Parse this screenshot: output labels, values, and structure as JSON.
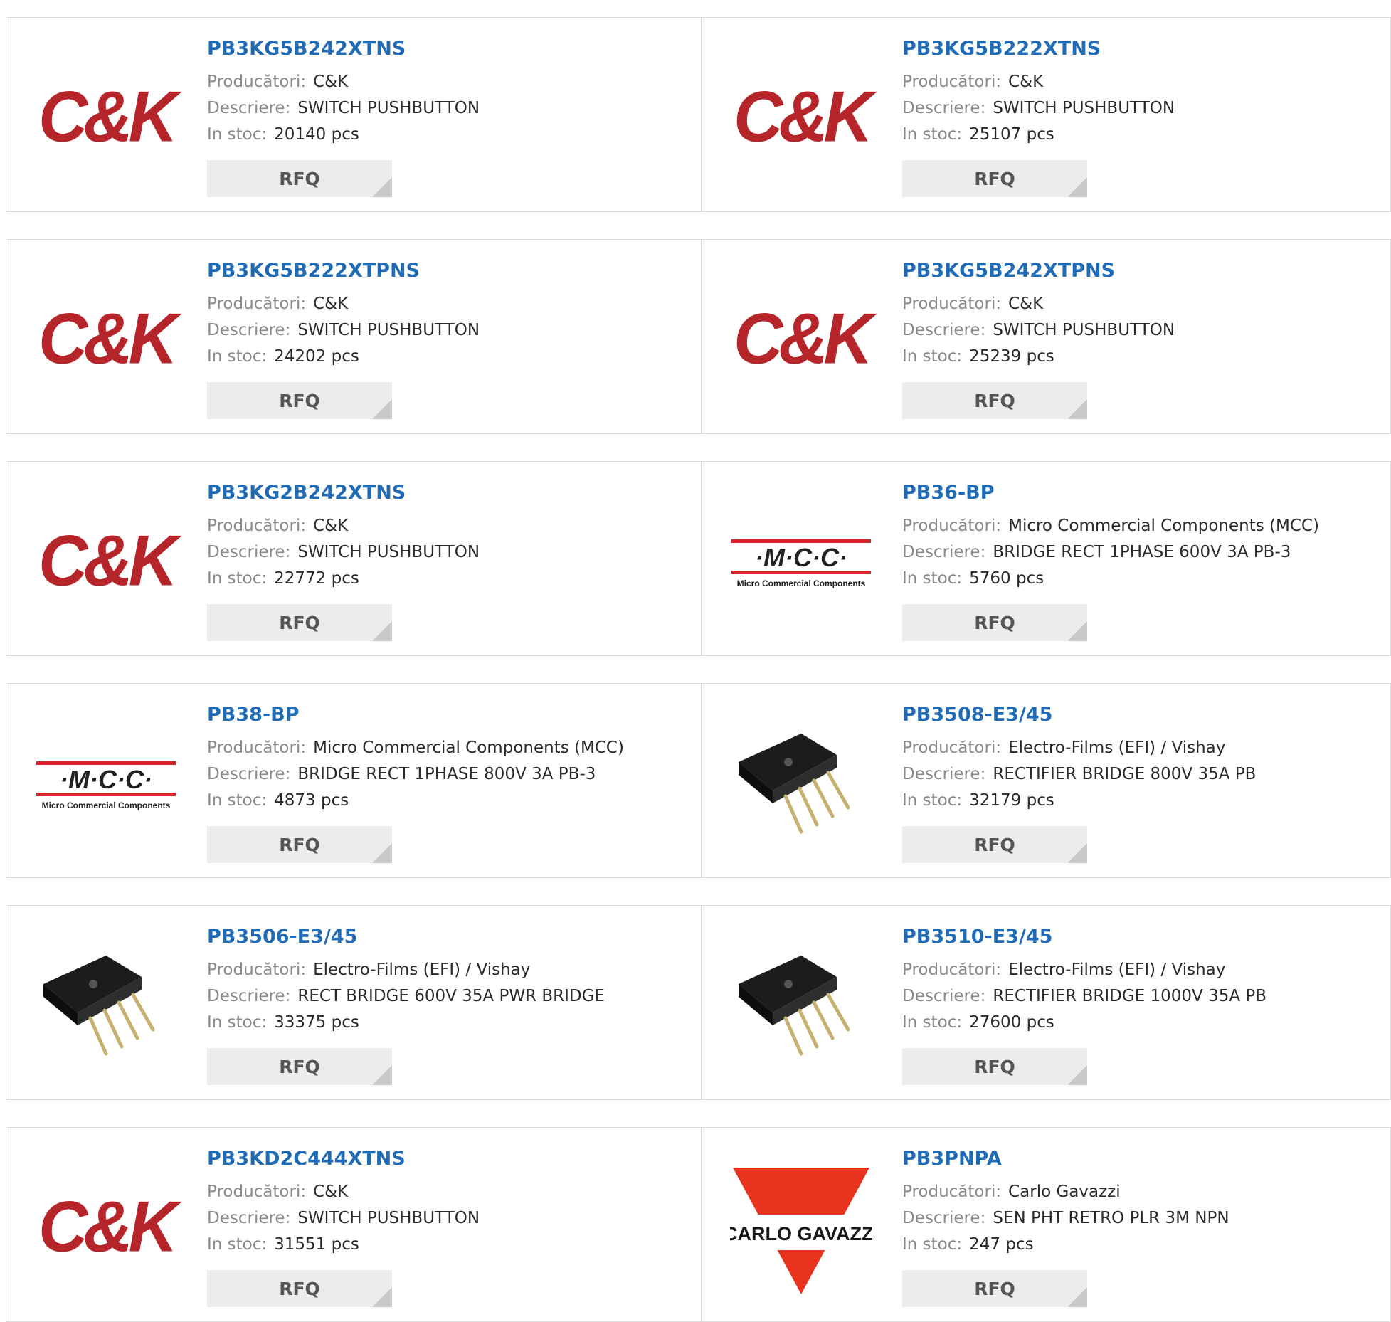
{
  "labels": {
    "manufacturer": "Producători:",
    "description": "Descriere:",
    "stock": "In stoc:",
    "rfq": "RFQ"
  },
  "products": [
    {
      "part": "PB3KG5B242XTNS",
      "manufacturer": "C&K",
      "description": "SWITCH PUSHBUTTON",
      "stock": "20140 pcs",
      "logo": "ck-logo"
    },
    {
      "part": "PB3KG5B222XTNS",
      "manufacturer": "C&K",
      "description": "SWITCH PUSHBUTTON",
      "stock": "25107 pcs",
      "logo": "ck-logo"
    },
    {
      "part": "PB3KG5B222XTPNS",
      "manufacturer": "C&K",
      "description": "SWITCH PUSHBUTTON",
      "stock": "24202 pcs",
      "logo": "ck-logo"
    },
    {
      "part": "PB3KG5B242XTPNS",
      "manufacturer": "C&K",
      "description": "SWITCH PUSHBUTTON",
      "stock": "25239 pcs",
      "logo": "ck-logo"
    },
    {
      "part": "PB3KG2B242XTNS",
      "manufacturer": "C&K",
      "description": "SWITCH PUSHBUTTON",
      "stock": "22772 pcs",
      "logo": "ck-logo"
    },
    {
      "part": "PB36-BP",
      "manufacturer": "Micro Commercial Components (MCC)",
      "description": "BRIDGE RECT 1PHASE 600V 3A PB-3",
      "stock": "5760 pcs",
      "logo": "mcc-logo",
      "logo_text": "·M·C·C·",
      "logo_sub": "Micro Commercial Components"
    },
    {
      "part": "PB38-BP",
      "manufacturer": "Micro Commercial Components (MCC)",
      "description": "BRIDGE RECT 1PHASE 800V 3A PB-3",
      "stock": "4873 pcs",
      "logo": "mcc-logo",
      "logo_text": "·M·C·C·",
      "logo_sub": "Micro Commercial Components"
    },
    {
      "part": "PB3508-E3/45",
      "manufacturer": "Electro-Films (EFI) / Vishay",
      "description": "RECTIFIER BRIDGE 800V 35A PB",
      "stock": "32179 pcs",
      "logo": "bridge-rectifier-image"
    },
    {
      "part": "PB3506-E3/45",
      "manufacturer": "Electro-Films (EFI) / Vishay",
      "description": "RECT BRIDGE 600V 35A PWR BRIDGE",
      "stock": "33375 pcs",
      "logo": "bridge-rectifier-image"
    },
    {
      "part": "PB3510-E3/45",
      "manufacturer": "Electro-Films (EFI) / Vishay",
      "description": "RECTIFIER BRIDGE 1000V 35A PB",
      "stock": "27600 pcs",
      "logo": "bridge-rectifier-image"
    },
    {
      "part": "PB3KD2C444XTNS",
      "manufacturer": "C&K",
      "description": "SWITCH PUSHBUTTON",
      "stock": "31551 pcs",
      "logo": "ck-logo"
    },
    {
      "part": "PB3PNPA",
      "manufacturer": "Carlo Gavazzi",
      "description": "SEN PHT RETRO PLR 3M NPN",
      "stock": "247 pcs",
      "logo": "carlo-gavazzi-logo",
      "logo_text": "CARLO GAVAZZI"
    }
  ],
  "colors": {
    "title": "#1f6bb5",
    "label": "#8a8a8a",
    "value": "#2a2a2a",
    "button_bg": "#ececec",
    "ck_red": "#b5252a",
    "mcc_red": "#d6262b",
    "gavazzi_red": "#e8331f"
  }
}
